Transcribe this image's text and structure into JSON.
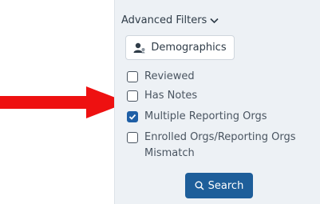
{
  "panel": {
    "advanced_filters_label": "Advanced Filters",
    "demographics_label": "Demographics",
    "search_label": "Search",
    "checkboxes": [
      {
        "label": "Reviewed",
        "checked": false
      },
      {
        "label": "Has Notes",
        "checked": false
      },
      {
        "label": "Multiple Reporting Orgs",
        "checked": true
      },
      {
        "label": "Enrolled Orgs/Reporting Orgs Mismatch",
        "checked": false
      }
    ]
  },
  "colors": {
    "arrow": "#ee1111",
    "panel_bg": "#edf1f5",
    "primary": "#1e5e9a"
  },
  "icons": {
    "arrow": "right-arrow-icon",
    "toggle": "chevron-down-icon",
    "demographics": "user-group-icon",
    "search": "search-icon"
  }
}
